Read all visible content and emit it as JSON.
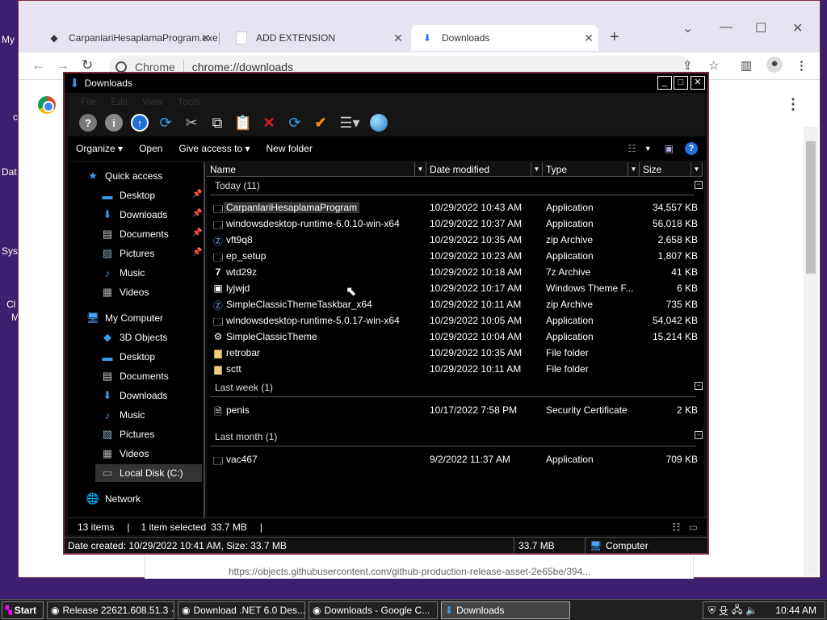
{
  "desktop": {
    "labels": [
      "My",
      "c",
      "Dat",
      "Sys",
      "Cl",
      "M"
    ]
  },
  "chrome": {
    "tabs": [
      {
        "label": "CarpanlariHesaplamaProgram.exe",
        "icon": "app-icon",
        "active": false
      },
      {
        "label": "ADD EXTENSION",
        "icon": "page-icon",
        "active": false
      },
      {
        "label": "Downloads",
        "icon": "download-icon",
        "active": true
      }
    ],
    "site_label": "Chrome",
    "url": "chrome://downloads",
    "download_url": "https://objects.githubusercontent.com/github-production-release-asset-2e65be/394..."
  },
  "explorer": {
    "title": "Downloads",
    "menu": [
      "File",
      "Edit",
      "View",
      "Tools"
    ],
    "commands": {
      "organize": "Organize",
      "open": "Open",
      "give_access": "Give access to",
      "new_folder": "New folder"
    },
    "nav": {
      "quick_access": "Quick access",
      "quick_items": [
        "Desktop",
        "Downloads",
        "Documents",
        "Pictures",
        "Music",
        "Videos"
      ],
      "my_computer": "My Computer",
      "computer_items": [
        "3D Objects",
        "Desktop",
        "Documents",
        "Downloads",
        "Music",
        "Pictures",
        "Videos",
        "Local Disk (C:)"
      ],
      "network": "Network"
    },
    "columns": {
      "name": "Name",
      "date": "Date modified",
      "type": "Type",
      "size": "Size"
    },
    "groups": [
      {
        "label": "Today (11)",
        "files": [
          {
            "name": "CarpanlariHesaplamaProgram",
            "date": "10/29/2022 10:43 AM",
            "type": "Application",
            "size": "34,557 KB",
            "icon": "app-icon"
          },
          {
            "name": "windowsdesktop-runtime-6.0.10-win-x64",
            "date": "10/29/2022 10:37 AM",
            "type": "Application",
            "size": "56,018 KB",
            "icon": "installer-icon"
          },
          {
            "name": "vft9q8",
            "date": "10/29/2022 10:35 AM",
            "type": "zip Archive",
            "size": "2,658 KB",
            "icon": "zip-icon"
          },
          {
            "name": "ep_setup",
            "date": "10/29/2022 10:23 AM",
            "type": "Application",
            "size": "1,807 KB",
            "icon": "app-icon"
          },
          {
            "name": "wtd29z",
            "date": "10/29/2022 10:18 AM",
            "type": "7z Archive",
            "size": "41 KB",
            "icon": "7z-icon"
          },
          {
            "name": "lyjwjd",
            "date": "10/29/2022 10:17 AM",
            "type": "Windows Theme F...",
            "size": "6 KB",
            "icon": "theme-icon"
          },
          {
            "name": "SimpleClassicThemeTaskbar_x64",
            "date": "10/29/2022 10:11 AM",
            "type": "zip Archive",
            "size": "735 KB",
            "icon": "zip-icon"
          },
          {
            "name": "windowsdesktop-runtime-5.0.17-win-x64",
            "date": "10/29/2022 10:05 AM",
            "type": "Application",
            "size": "54,042 KB",
            "icon": "installer-icon"
          },
          {
            "name": "SimpleClassicTheme",
            "date": "10/29/2022 10:04 AM",
            "type": "Application",
            "size": "15,214 KB",
            "icon": "app-icon"
          },
          {
            "name": "retrobar",
            "date": "10/29/2022 10:35 AM",
            "type": "File folder",
            "size": "",
            "icon": "folder-icon"
          },
          {
            "name": "sctt",
            "date": "10/29/2022 10:11 AM",
            "type": "File folder",
            "size": "",
            "icon": "folder-icon"
          }
        ]
      },
      {
        "label": "Last week (1)",
        "files": [
          {
            "name": "penis",
            "date": "10/17/2022 7:58 PM",
            "type": "Security Certificate",
            "size": "2 KB",
            "icon": "certificate-icon"
          }
        ]
      },
      {
        "label": "Last month (1)",
        "files": [
          {
            "name": "vac467",
            "date": "9/2/2022 11:37 AM",
            "type": "Application",
            "size": "709 KB",
            "icon": "app-icon"
          }
        ]
      }
    ],
    "status": {
      "items": "13 items",
      "selected": "1 item selected",
      "selected_size": "33.7 MB",
      "details": "Date created: 10/29/2022 10:41 AM, Size: 33.7 MB",
      "size": "33.7 MB",
      "location": "Computer"
    }
  },
  "taskbar": {
    "start": "Start",
    "buttons": [
      {
        "label": "Release 22621.608.51.3 ·...",
        "active": false
      },
      {
        "label": "Download .NET 6.0 Des...",
        "active": false
      },
      {
        "label": "Downloads - Google C...",
        "active": false
      },
      {
        "label": "Downloads",
        "active": true
      }
    ],
    "clock": "10:44 AM"
  }
}
